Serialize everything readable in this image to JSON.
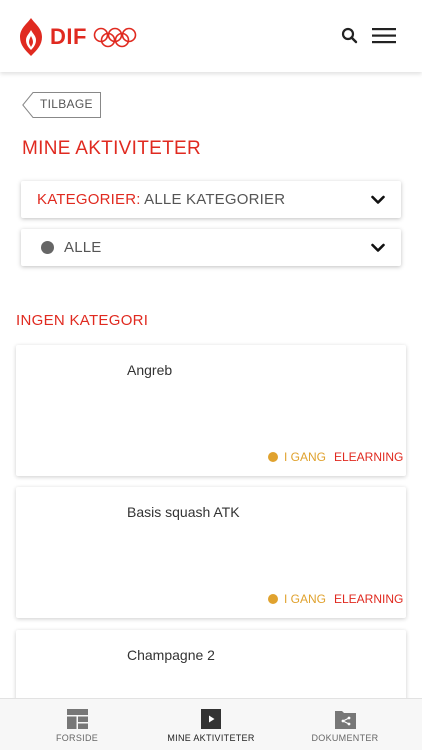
{
  "header": {
    "logo_text": "DIF",
    "brand_color": "#e02a20"
  },
  "back_label": "TILBAGE",
  "page_title": "MINE AKTIVITETER",
  "filters": {
    "category_label": "KATEGORIER:",
    "category_value": "ALLE KATEGORIER",
    "status_value": "ALLE"
  },
  "section_title": "INGEN KATEGORI",
  "activities": [
    {
      "title": "Angreb",
      "status": "I GANG",
      "type": "ELEARNING"
    },
    {
      "title": "Basis squash ATK",
      "status": "I GANG",
      "type": "ELEARNING"
    },
    {
      "title": "Champagne 2",
      "status": "",
      "type": ""
    }
  ],
  "bottom_nav": [
    {
      "label": "FORSIDE",
      "icon": "home-grid-icon"
    },
    {
      "label": "MINE AKTIVITETER",
      "icon": "play-icon",
      "active": true
    },
    {
      "label": "DOKUMENTER",
      "icon": "folder-share-icon"
    }
  ]
}
